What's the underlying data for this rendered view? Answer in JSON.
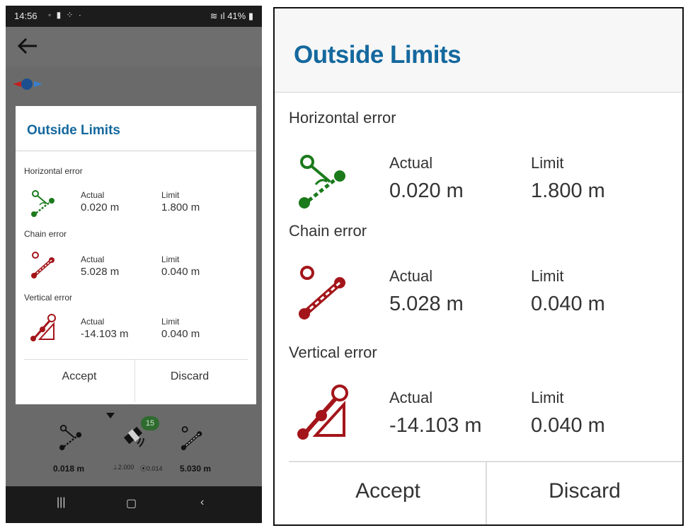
{
  "status_bar": {
    "time": "14:56",
    "signal_battery": "41%"
  },
  "dialog": {
    "title": "Outside Limits",
    "col_actual": "Actual",
    "col_limit": "Limit",
    "rows": [
      {
        "label": "Horizontal error",
        "actual": "0.020 m",
        "limit": "1.800 m",
        "icon": "horizontal-error-icon",
        "color": "#1b7a1b"
      },
      {
        "label": "Chain error",
        "actual": "5.028 m",
        "limit": "0.040 m",
        "icon": "chain-error-icon",
        "color": "#a3151a"
      },
      {
        "label": "Vertical error",
        "actual": "-14.103 m",
        "limit": "0.040 m",
        "icon": "vertical-error-icon",
        "color": "#a3151a"
      }
    ],
    "accept_label": "Accept",
    "discard_label": "Discard"
  },
  "bottom_panel": {
    "left_value": "0.018 m",
    "center_left": "2.000",
    "center_right": "0.014",
    "right_value": "5.030 m",
    "satellite_count": "15"
  },
  "colors": {
    "title": "#14689e",
    "green": "#1b7a1b",
    "red": "#a3151a"
  }
}
